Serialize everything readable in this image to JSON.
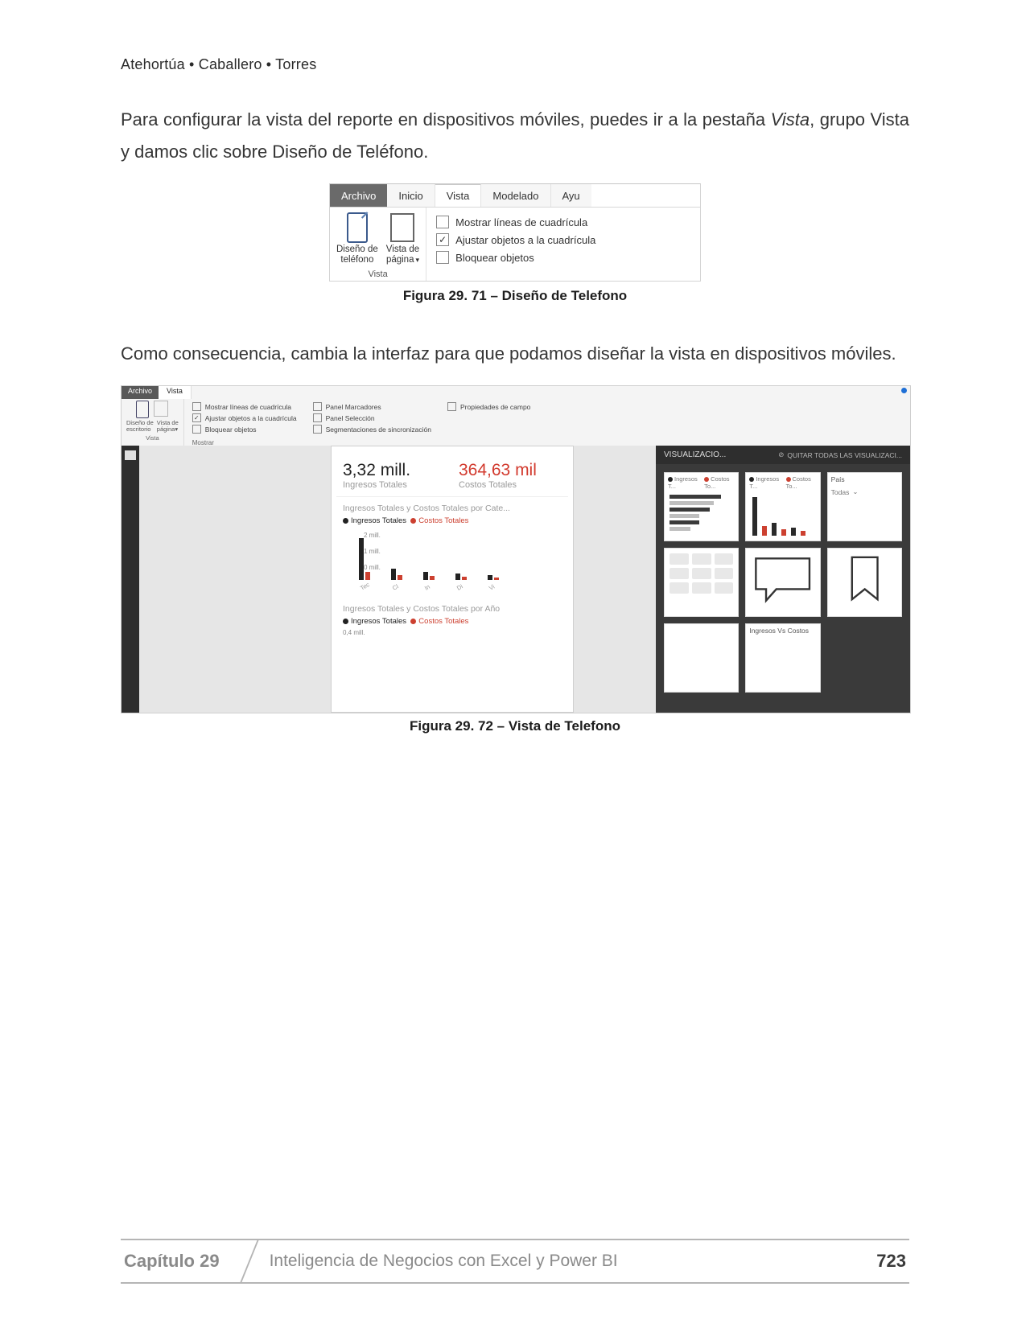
{
  "running_head": "Atehortúa • Caballero • Torres",
  "para1_a": "Para configurar la vista del reporte en dispositivos móviles, puedes ir a la pestaña ",
  "para1_vista": "Vista",
  "para1_b": ", grupo Vista y damos clic sobre Diseño de Teléfono.",
  "fig1": {
    "tabs": {
      "archivo": "Archivo",
      "inicio": "Inicio",
      "vista": "Vista",
      "modelado": "Modelado",
      "ayuda": "Ayu"
    },
    "phone_label_1": "Diseño de",
    "phone_label_2": "teléfono",
    "page_label_1": "Vista de",
    "page_label_2": "página",
    "page_caret": "▾",
    "group_vista": "Vista",
    "chk_grid": "Mostrar líneas de cuadrícula",
    "chk_snap": "Ajustar objetos a la cuadrícula",
    "chk_lock": "Bloquear objetos",
    "caption": "Figura 29. 71 –  Diseño de Telefono"
  },
  "para2": "Como consecuencia, cambia la interfaz para que podamos diseñar la vista en dispositivos móviles.",
  "fig2": {
    "tabs": {
      "archivo": "Archivo",
      "vista": "Vista"
    },
    "g1": {
      "l1a": "Diseño de",
      "l1b": "escritorio",
      "l2a": "Vista de",
      "l2b": "página",
      "caret": "▾",
      "cap": "Vista"
    },
    "col1": {
      "a": "Mostrar líneas de cuadrícula",
      "b": "Ajustar objetos a la cuadrícula",
      "c": "Bloquear objetos"
    },
    "col2": {
      "a": "Panel Marcadores",
      "b": "Panel Selección",
      "c": "Segmentaciones de sincronización"
    },
    "col3": {
      "a": "Propiedades de campo"
    },
    "mostrar_cap": "Mostrar",
    "kpi1_val": "3,32 mill.",
    "kpi1_lbl": "Ingresos Totales",
    "kpi2_val": "364,63 mil",
    "kpi2_lbl": "Costos Totales",
    "tile1_title": "Ingresos Totales y Costos Totales por Cate...",
    "legend_ing": "Ingresos Totales",
    "legend_cos": "Costos Totales",
    "y2": "2 mill.",
    "y1": "1 mill.",
    "y0": "0 mill.",
    "x": [
      "Tec",
      "Cl",
      "In",
      "Di",
      "Vi"
    ],
    "tile2_title": "Ingresos Totales y Costos Totales por Año",
    "tile2_y": "0,4 mill.",
    "viz_title": "VISUALIZACIO...",
    "viz_clear_icon": "⊘",
    "viz_clear": "QUITAR TODAS LAS VISUALIZACI...",
    "thdr_ing": "Ingresos T...",
    "thdr_cos": "Costos To...",
    "tile_pais": "País",
    "tile_todas": "Todas",
    "tile_chev": "⌄",
    "tile_ivc": "Ingresos Vs Costos",
    "caption": "Figura 29. 72 –  Vista de Telefono"
  },
  "footer": {
    "chapter": "Capítulo 29",
    "title": "Inteligencia de Negocios con Excel y Power BI",
    "page": "723"
  }
}
